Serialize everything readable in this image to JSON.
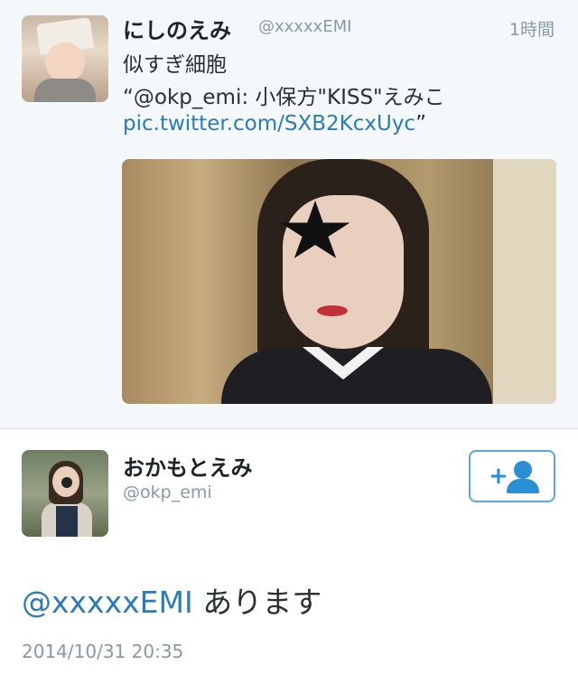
{
  "tweet": {
    "author_name": "にしのえみ",
    "author_handle": "@xxxxxEMI",
    "time": "1時間",
    "line1": "似すぎ細胞",
    "line2": "“@okp_emi: 小保方\"KISS\"えみこ",
    "link": "pic.twitter.com/SXB2KcxUyc",
    "link_suffix": "”"
  },
  "reply": {
    "author_name": "おかもとえみ",
    "author_handle": "@okp_emi",
    "mention": "@xxxxxEMI",
    "text": " あります",
    "timestamp": "2014/10/31 20:35"
  },
  "colors": {
    "link": "#2b7bb9",
    "secondary": "#8899a6",
    "accent": "#2b8fd6"
  }
}
